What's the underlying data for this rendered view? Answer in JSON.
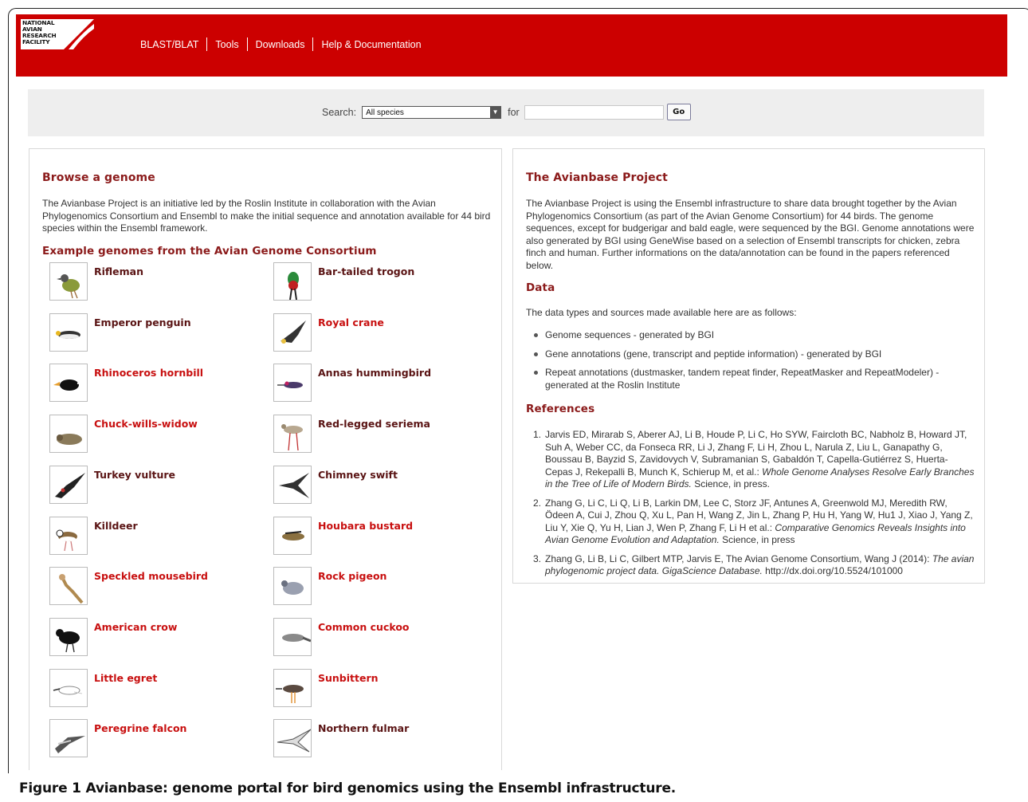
{
  "logo": {
    "text": "NATIONAL\nAVIAN\nRESEARCH\nFACILITY"
  },
  "nav": [
    "BLAST/BLAT",
    "Tools",
    "Downloads",
    "Help & Documentation"
  ],
  "search": {
    "label": "Search:",
    "selected": "All species",
    "for_label": "for",
    "value": "",
    "go": "Go"
  },
  "browse": {
    "title": "Browse a genome",
    "intro": "The Avianbase Project is an initiative led by the Roslin Institute in collaboration with the Avian Phylogenomics Consortium and Ensembl to make the initial sequence and annotation available for 44 bird species within the Ensembl framework.",
    "subtitle": "Example genomes from the Avian Genome Consortium",
    "birds_left": [
      {
        "name": "Rifleman",
        "tone": "dark",
        "icon": "rifleman-icon"
      },
      {
        "name": "Emperor penguin",
        "tone": "dark",
        "icon": "penguin-icon"
      },
      {
        "name": "Rhinoceros hornbill",
        "tone": "red",
        "icon": "hornbill-icon"
      },
      {
        "name": "Chuck-wills-widow",
        "tone": "red",
        "icon": "nightjar-icon"
      },
      {
        "name": "Turkey vulture",
        "tone": "dark",
        "icon": "vulture-icon"
      },
      {
        "name": "Killdeer",
        "tone": "dark",
        "icon": "killdeer-icon"
      },
      {
        "name": "Speckled mousebird",
        "tone": "red",
        "icon": "mousebird-icon"
      },
      {
        "name": "American crow",
        "tone": "red",
        "icon": "crow-icon"
      },
      {
        "name": "Little egret",
        "tone": "red",
        "icon": "egret-icon"
      },
      {
        "name": "Peregrine falcon",
        "tone": "red",
        "icon": "falcon-icon"
      }
    ],
    "birds_right": [
      {
        "name": "Bar-tailed trogon",
        "tone": "dark",
        "icon": "trogon-icon"
      },
      {
        "name": "Royal crane",
        "tone": "red",
        "icon": "crane-icon"
      },
      {
        "name": "Annas hummingbird",
        "tone": "dark",
        "icon": "hummingbird-icon"
      },
      {
        "name": "Red-legged seriema",
        "tone": "dark",
        "icon": "seriema-icon"
      },
      {
        "name": "Chimney swift",
        "tone": "dark",
        "icon": "swift-icon"
      },
      {
        "name": "Houbara bustard",
        "tone": "red",
        "icon": "bustard-icon"
      },
      {
        "name": "Rock pigeon",
        "tone": "red",
        "icon": "pigeon-icon"
      },
      {
        "name": "Common cuckoo",
        "tone": "red",
        "icon": "cuckoo-icon"
      },
      {
        "name": "Sunbittern",
        "tone": "red",
        "icon": "sunbittern-icon"
      },
      {
        "name": "Northern fulmar",
        "tone": "dark",
        "icon": "fulmar-icon"
      }
    ]
  },
  "project": {
    "title": "The Avianbase Project",
    "intro": "The Avianbase Project is using the Ensembl infrastructure to share data brought together by the Avian Phylogenomics Consortium (as part of the Avian Genome Consortium) for 44 birds. The genome sequences, except for budgerigar and bald eagle, were sequenced by the BGI. Genome annotations were also generated by BGI using GeneWise based on a selection of Ensembl transcripts for chicken, zebra finch and human. Further informations on the data/annotation can be found in the papers referenced below.",
    "data_title": "Data",
    "data_intro": "The data types and sources made available here are as follows:",
    "data_items": [
      "Genome sequences - generated by BGI",
      "Gene annotations (gene, transcript and peptide information) - generated by BGI",
      "Repeat annotations (dustmasker, tandem repeat finder, RepeatMasker and RepeatModeler) - generated at the Roslin Institute"
    ],
    "refs_title": "References",
    "refs": [
      {
        "num": "1.",
        "authors": "Jarvis ED, Mirarab S, Aberer AJ, Li B, Houde P, Li C, Ho SYW, Faircloth BC, Nabholz B, Howard JT, Suh A, Weber CC, da Fonseca RR, Li J, Zhang F, Li H, Zhou L, Narula Z, Liu L, Ganapathy G, Boussau B, Bayzid S, Zavidovych V, Subramanian S, Gabaldón T, Capella-Gutiérrez S, Huerta-Cepas J, Rekepalli B, Munch K, Schierup M, et al.: ",
        "title": "Whole Genome Analyses Resolve Early Branches in the Tree of Life of Modern Birds.",
        "tail": " Science, in press."
      },
      {
        "num": "2.",
        "authors": "Zhang G, Li C, Li Q, Li B, Larkin DM, Lee C, Storz JF, Antunes A, Greenwold MJ, Meredith RW, Ödeen A, Cui J, Zhou Q, Xu L, Pan H, Wang Z, Jin L, Zhang P, Hu H, Yang W, Hu1 J, Xiao J, Yang Z, Liu Y, Xie Q, Yu H, Lian J, Wen P, Zhang F, Li H et al.: ",
        "title": "Comparative Genomics Reveals Insights into Avian Genome Evolution and Adaptation.",
        "tail": " Science, in press"
      },
      {
        "num": "3.",
        "authors": "Zhang G, Li B, Li C, Gilbert MTP, Jarvis E, The Avian Genome Consortium, Wang J (2014): ",
        "title": "The avian phylogenomic project data. GigaScience Database.",
        "tail": " http://dx.doi.org/10.5524/101000"
      }
    ]
  },
  "caption": {
    "label": "Figure 1",
    "text": " Avianbase: genome portal for bird genomics using the Ensembl infrastructure."
  },
  "colors": {
    "header": "#cc0000",
    "heading": "#8b1a1a",
    "link_red": "#c81010",
    "link_dark": "#5a1414"
  }
}
